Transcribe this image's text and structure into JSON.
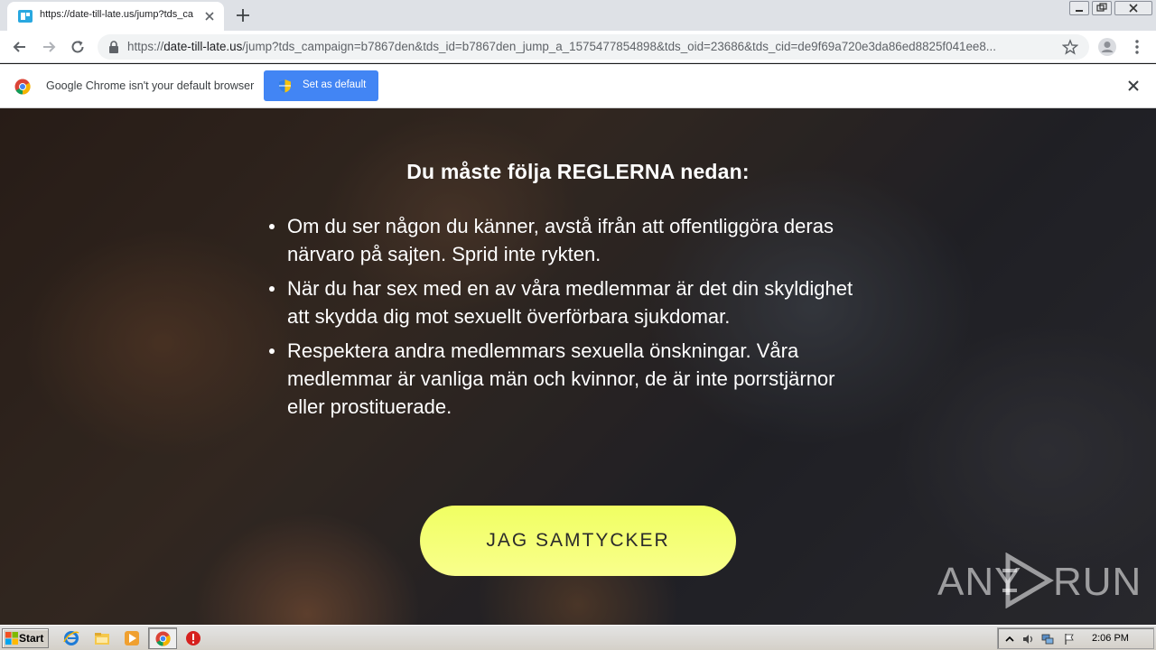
{
  "browser": {
    "tab": {
      "title": "https://date-till-late.us/jump?tds_ca",
      "favicon": "site-favicon"
    },
    "address": {
      "scheme": "https://",
      "host": "date-till-late.us",
      "path": "/jump?tds_campaign=b7867den&tds_id=b7867den_jump_a_1575477854898&tds_oid=23686&tds_cid=de9f69a720e3da86ed8825f041ee8..."
    }
  },
  "infobar": {
    "message": "Google Chrome isn't your default browser",
    "button_label": "Set as default"
  },
  "page": {
    "heading": "Du måste följa REGLERNA nedan:",
    "rules": [
      "Om du ser någon du känner, avstå ifrån att offentliggöra deras närvaro på sajten. Sprid inte rykten.",
      "När du har sex med en av våra medlemmar är det din skyldighet att skydda dig mot sexuellt överförbara sjukdomar.",
      "Respektera andra medlemmars sexuella önskningar. Våra medlemmar är vanliga män och kvinnor, de är inte porrstjärnor eller prostituerade."
    ],
    "agree_button": "JAG SAMTYCKER",
    "button_color": "#f4ff75"
  },
  "watermark": {
    "left": "ANY",
    "right": "RUN"
  },
  "taskbar": {
    "start_label": "Start",
    "clock": "2:06 PM"
  },
  "colors": {
    "accent_blue": "#4285f4",
    "button_yellow": "#f4ff75"
  }
}
